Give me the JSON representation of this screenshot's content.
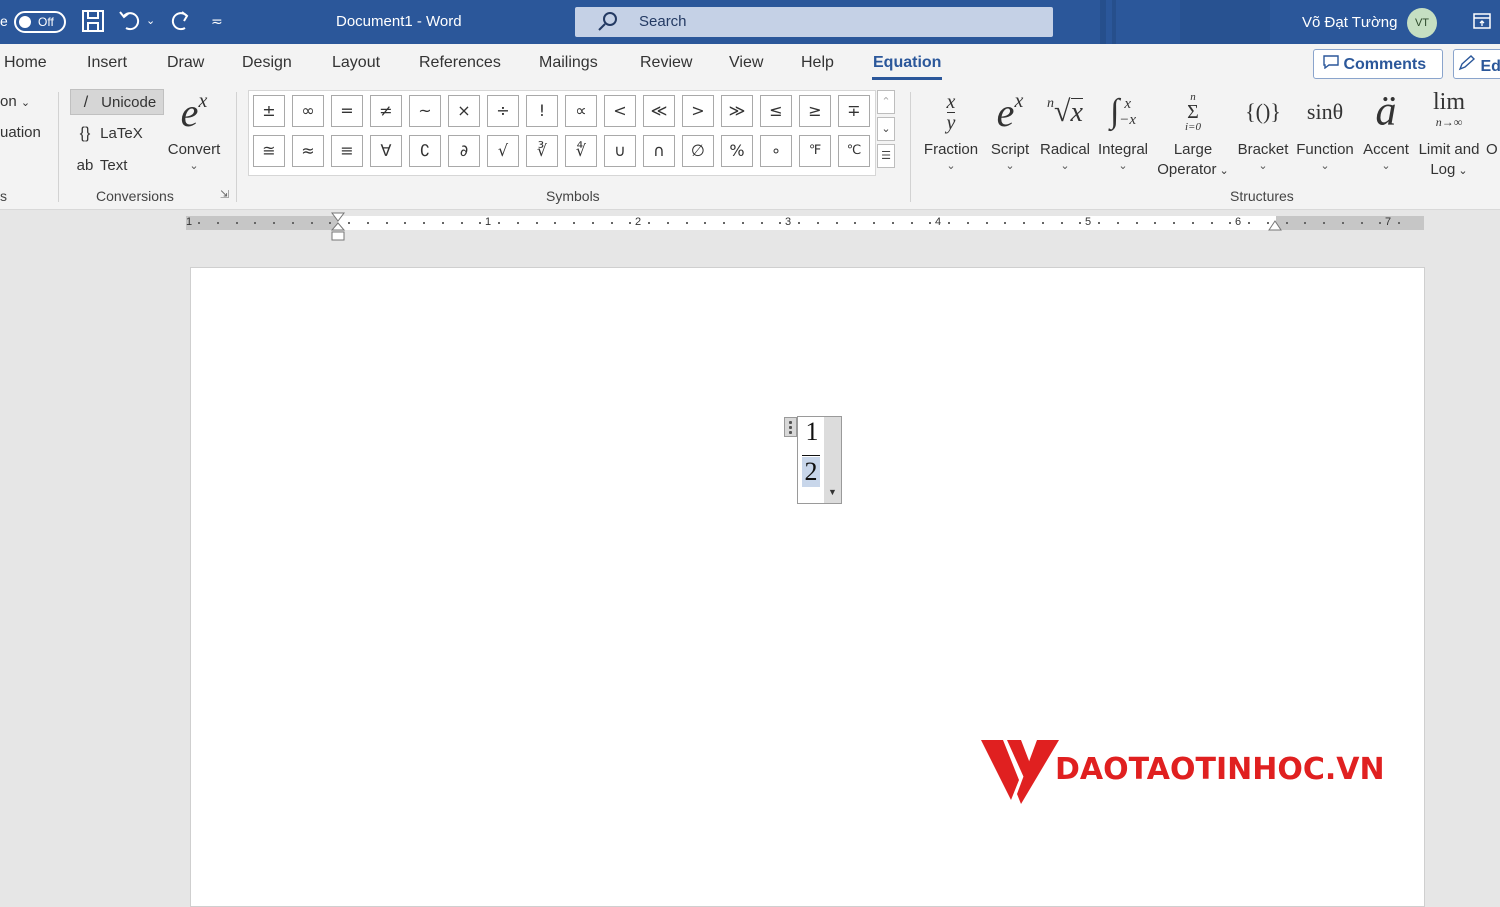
{
  "titlebar": {
    "autosave_label": "e",
    "autosave_toggle": "Off",
    "document_title": "Document1  -  Word",
    "search_placeholder": "Search",
    "user_name": "Võ Đạt Tường",
    "user_initials": "VT"
  },
  "tabs": [
    "Home",
    "Insert",
    "Draw",
    "Design",
    "Layout",
    "References",
    "Mailings",
    "Review",
    "View",
    "Help",
    "Equation"
  ],
  "active_tab": "Equation",
  "buttons": {
    "comments": "Comments",
    "edit": "Ed"
  },
  "ribbon": {
    "tools_partial": {
      "equation_label": "on",
      "ink_label": "uation",
      "group_label": "s"
    },
    "conversions": {
      "items": [
        "Unicode",
        "LaTeX",
        "Text"
      ],
      "selected": "Unicode",
      "convert_label": "Convert",
      "group_label": "Conversions"
    },
    "symbols": {
      "row1": [
        "±",
        "∞",
        "=",
        "≠",
        "~",
        "×",
        "÷",
        "!",
        "∝",
        "<",
        "≪",
        ">",
        "≫",
        "≤",
        "≥",
        "∓"
      ],
      "row2": [
        "≅",
        "≈",
        "≡",
        "∀",
        "∁",
        "∂",
        "√",
        "∛",
        "∜",
        "∪",
        "∩",
        "∅",
        "%",
        "∘",
        "℉",
        "℃"
      ],
      "group_label": "Symbols"
    },
    "structures": {
      "items": [
        "Fraction",
        "Script",
        "Radical",
        "Integral",
        "Large Operator",
        "Bracket",
        "Function",
        "Accent",
        "Limit and Log",
        "O"
      ],
      "group_label": "Structures"
    }
  },
  "ruler": {
    "numbers": [
      "1",
      "1",
      "2",
      "3",
      "4",
      "5",
      "6",
      "7"
    ]
  },
  "equation": {
    "numerator": "1",
    "denominator": "2"
  },
  "watermark": {
    "text": "DAOTAOTINHOC.VN",
    "color": "#e02020"
  },
  "colors": {
    "accent": "#2b579a",
    "ribbon": "#f3f3f3",
    "canvas": "#e6e6e6"
  }
}
